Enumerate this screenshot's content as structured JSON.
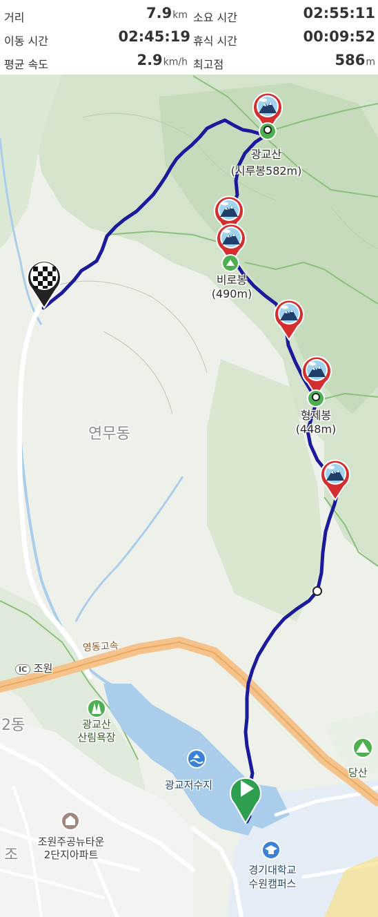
{
  "stats": {
    "distance": {
      "label": "거리",
      "value": "7.9",
      "unit": "km"
    },
    "duration": {
      "label": "소요 시간",
      "value": "02:55:11"
    },
    "moving_time": {
      "label": "이동 시간",
      "value": "02:45:19"
    },
    "rest_time": {
      "label": "휴식 시간",
      "value": "00:09:52"
    },
    "avg_speed": {
      "label": "평균 속도",
      "value": "2.9",
      "unit": "km/h"
    },
    "max_elevation": {
      "label": "최고점",
      "value": "586",
      "unit": "m"
    }
  },
  "map": {
    "peaks": [
      {
        "name": "광교산",
        "elev": "(시루봉582m)"
      },
      {
        "name": "비로봉",
        "elev": "(490m)"
      },
      {
        "name": "형제봉",
        "elev": "(448m)"
      }
    ],
    "areas": {
      "yeonmu": "연무동",
      "jo": "조",
      "dong2": "2동"
    },
    "roads": {
      "expressway": "영동고속",
      "ic_badge": "IC",
      "ic_name": "조원"
    },
    "pois": {
      "forest": "광교산\n산림욕장",
      "reservoir": "광교저수지",
      "apartment": "조원주공뉴타운\n2단지아파트",
      "university": "경기대학교\n수원캠퍼스",
      "dangsan": "당산"
    },
    "colors": {
      "track": "#1a1a9a",
      "mountain_marker": "#d32f2f",
      "peak_marker": "#4caf50",
      "expressway": "#f4c28a",
      "water": "#a9cdea"
    }
  }
}
